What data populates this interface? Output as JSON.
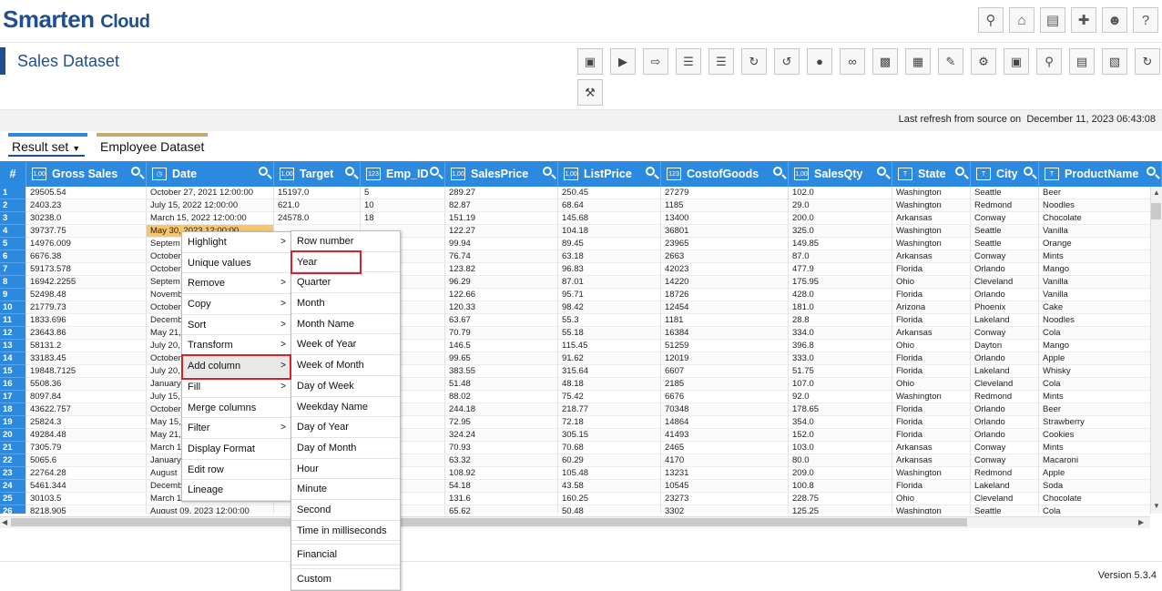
{
  "app": {
    "logo_main": "Smarten",
    "logo_sub": "Cloud",
    "version": "Version 5.3.4"
  },
  "top_icons": [
    "search-icon",
    "home-icon",
    "folder-icon",
    "plus-icon",
    "user-icon",
    "help-icon"
  ],
  "page": {
    "title": "Sales Dataset",
    "refresh_label": "Last refresh from source on",
    "refresh_time": "December 11, 2023 06:43:08"
  },
  "tools": [
    "save-icon",
    "announce-icon",
    "export-icon",
    "sql-icon",
    "database-icon",
    "transform-icon",
    "refresh-icon",
    "join-icon",
    "link-icon",
    "merge-icon",
    "grid-icon",
    "chart-icon",
    "settings-icon",
    "image-icon",
    "db-search-icon",
    "copy-icon",
    "binary-icon",
    "reload-icon",
    "tools-icon"
  ],
  "tabs": [
    {
      "label": "Result set",
      "active": true,
      "color": "#2b8ae0"
    },
    {
      "label": "Employee Dataset",
      "active": false,
      "color": "#c8a96e"
    }
  ],
  "grid": {
    "rownum_header": "#",
    "columns": [
      {
        "label": "Gross Sales",
        "type": "numeric"
      },
      {
        "label": "Date",
        "type": "date"
      },
      {
        "label": "Target",
        "type": "numeric"
      },
      {
        "label": "Emp_ID",
        "type": "integer"
      },
      {
        "label": "SalesPrice",
        "type": "numeric"
      },
      {
        "label": "ListPrice",
        "type": "numeric"
      },
      {
        "label": "CostofGoods",
        "type": "integer"
      },
      {
        "label": "SalesQty",
        "type": "numeric"
      },
      {
        "label": "State",
        "type": "text"
      },
      {
        "label": "City",
        "type": "text"
      },
      {
        "label": "ProductName",
        "type": "text"
      }
    ],
    "type_labels": {
      "numeric": "1,00",
      "date": "◷",
      "integer": "123",
      "text": "T"
    },
    "rows": [
      [
        "1",
        "29505.54",
        "October 27, 2021 12:00:00",
        "15197.0",
        "5",
        "289.27",
        "250.45",
        "27279",
        "102.0",
        "Washington",
        "Seattle",
        "Beer"
      ],
      [
        "2",
        "2403.23",
        "July 15, 2022 12:00:00",
        "621.0",
        "10",
        "82.87",
        "68.64",
        "1185",
        "29.0",
        "Washington",
        "Redmond",
        "Noodles"
      ],
      [
        "3",
        "30238.0",
        "March 15, 2022 12:00:00",
        "24578.0",
        "18",
        "151.19",
        "145.68",
        "13400",
        "200.0",
        "Arkansas",
        "Conway",
        "Chocolate"
      ],
      [
        "4",
        "39737.75",
        "May 30, 2023 12:00:00",
        "",
        "",
        "122.27",
        "104.18",
        "36801",
        "325.0",
        "Washington",
        "Seattle",
        "Vanilla"
      ],
      [
        "5",
        "14976.009",
        "Septem",
        "",
        "",
        "99.94",
        "89.45",
        "23965",
        "149.85",
        "Washington",
        "Seattle",
        "Orange"
      ],
      [
        "6",
        "6676.38",
        "October",
        "",
        "",
        "76.74",
        "63.18",
        "2663",
        "87.0",
        "Arkansas",
        "Conway",
        "Mints"
      ],
      [
        "7",
        "59173.578",
        "October",
        "",
        "",
        "123.82",
        "96.83",
        "42023",
        "477.9",
        "Florida",
        "Orlando",
        "Mango"
      ],
      [
        "8",
        "16942.2255",
        "Septem",
        "",
        "",
        "96.29",
        "87.01",
        "14220",
        "175.95",
        "Ohio",
        "Cleveland",
        "Vanilla"
      ],
      [
        "9",
        "52498.48",
        "Novemb",
        "",
        "",
        "122.66",
        "95.71",
        "18726",
        "428.0",
        "Florida",
        "Orlando",
        "Vanilla"
      ],
      [
        "10",
        "21779.73",
        "October",
        "",
        "",
        "120.33",
        "98.42",
        "12454",
        "181.0",
        "Arizona",
        "Phoenix",
        "Cake"
      ],
      [
        "11",
        "1833.696",
        "Decemb",
        "",
        "",
        "63.67",
        "55.3",
        "1181",
        "28.8",
        "Florida",
        "Lakeland",
        "Noodles"
      ],
      [
        "12",
        "23643.86",
        "May 21,",
        "",
        "",
        "70.79",
        "55.18",
        "16384",
        "334.0",
        "Arkansas",
        "Conway",
        "Cola"
      ],
      [
        "13",
        "58131.2",
        "July 20,",
        "",
        "",
        "146.5",
        "115.45",
        "51259",
        "396.8",
        "Ohio",
        "Dayton",
        "Mango"
      ],
      [
        "14",
        "33183.45",
        "October",
        "",
        "",
        "99.65",
        "91.62",
        "12019",
        "333.0",
        "Florida",
        "Orlando",
        "Apple"
      ],
      [
        "15",
        "19848.7125",
        "July 20,",
        "",
        "",
        "383.55",
        "315.64",
        "6607",
        "51.75",
        "Florida",
        "Lakeland",
        "Whisky"
      ],
      [
        "16",
        "5508.36",
        "January",
        "",
        "",
        "51.48",
        "48.18",
        "2185",
        "107.0",
        "Ohio",
        "Cleveland",
        "Cola"
      ],
      [
        "17",
        "8097.84",
        "July 15,",
        "",
        "",
        "88.02",
        "75.42",
        "6676",
        "92.0",
        "Washington",
        "Redmond",
        "Mints"
      ],
      [
        "18",
        "43622.757",
        "October",
        "",
        "",
        "244.18",
        "218.77",
        "70348",
        "178.65",
        "Florida",
        "Orlando",
        "Beer"
      ],
      [
        "19",
        "25824.3",
        "May 15,",
        "",
        "",
        "72.95",
        "72.18",
        "14864",
        "354.0",
        "Florida",
        "Orlando",
        "Strawberry"
      ],
      [
        "20",
        "49284.48",
        "May 21,",
        "",
        "",
        "324.24",
        "305.15",
        "41493",
        "152.0",
        "Florida",
        "Orlando",
        "Cookies"
      ],
      [
        "21",
        "7305.79",
        "March 1",
        "",
        "",
        "70.93",
        "70.68",
        "2465",
        "103.0",
        "Arkansas",
        "Conway",
        "Mints"
      ],
      [
        "22",
        "5065.6",
        "January",
        "",
        "",
        "63.32",
        "60.29",
        "4170",
        "80.0",
        "Arkansas",
        "Conway",
        "Macaroni"
      ],
      [
        "23",
        "22764.28",
        "August",
        "",
        "",
        "108.92",
        "105.48",
        "13231",
        "209.0",
        "Washington",
        "Redmond",
        "Apple"
      ],
      [
        "24",
        "5461.344",
        "Decemb",
        "",
        "",
        "54.18",
        "43.58",
        "10545",
        "100.8",
        "Florida",
        "Lakeland",
        "Soda"
      ],
      [
        "25",
        "30103.5",
        "March 1",
        "",
        "",
        "131.6",
        "160.25",
        "23273",
        "228.75",
        "Ohio",
        "Cleveland",
        "Chocolate"
      ],
      [
        "26",
        "8218.905",
        "August 09, 2023 12:00:00",
        "",
        "",
        "65.62",
        "50.48",
        "3302",
        "125.25",
        "Washington",
        "Seattle",
        "Cola"
      ]
    ]
  },
  "context_menu": {
    "items": [
      {
        "label": "Highlight",
        "has_sub": true
      },
      {
        "label": "Unique values",
        "has_sub": false
      },
      {
        "label": "Remove",
        "has_sub": true
      },
      {
        "label": "Copy",
        "has_sub": true
      },
      {
        "label": "Sort",
        "has_sub": true
      },
      {
        "label": "Transform",
        "has_sub": true
      },
      {
        "label": "Add column",
        "has_sub": true,
        "highlighted": true
      },
      {
        "label": "Fill",
        "has_sub": true
      },
      {
        "label": "Merge columns",
        "has_sub": false
      },
      {
        "label": "Filter",
        "has_sub": true
      },
      {
        "label": "Display Format",
        "has_sub": false
      },
      {
        "label": "Edit row",
        "has_sub": false
      },
      {
        "label": "Lineage",
        "has_sub": false
      }
    ],
    "sub_arrow": ">"
  },
  "add_column_submenu": {
    "items": [
      "Row number",
      "Year",
      "Quarter",
      "Month",
      "Month Name",
      "Week of Year",
      "Week of Month",
      "Day of Week",
      "Weekday Name",
      "Day of Year",
      "Day of Month",
      "Hour",
      "Minute",
      "Second",
      "Time in milliseconds",
      "Financial",
      "Custom"
    ],
    "highlighted": "Year"
  }
}
